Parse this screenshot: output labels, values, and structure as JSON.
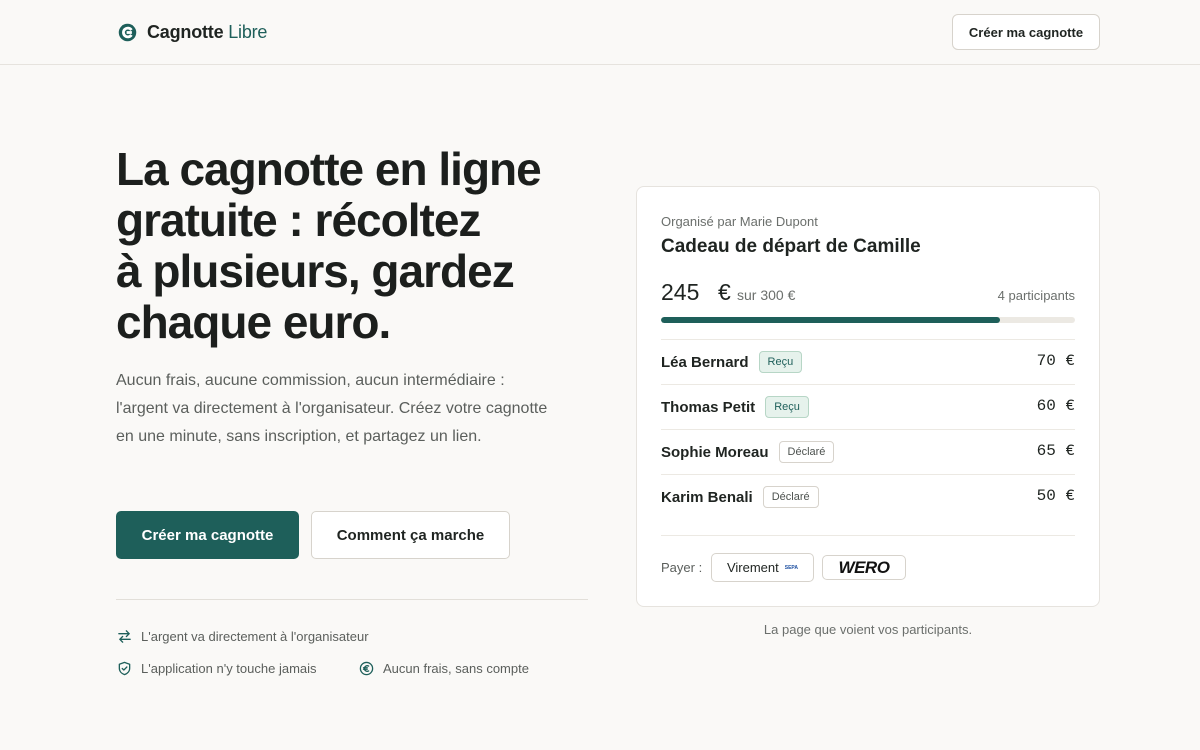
{
  "header": {
    "brand_name": "Cagnotte",
    "brand_accent": "Libre",
    "cta_label": "Créer ma cagnotte"
  },
  "hero": {
    "title_lines": [
      "La cagnotte en ligne",
      "gratuite : récoltez",
      "à plusieurs, gardez",
      "chaque euro."
    ],
    "description": "Aucun frais, aucune commission, aucun intermédiaire : l'argent va directement à l'organisateur. Créez votre cagnotte en une minute, sans inscription, et partagez un lien.",
    "primary_button": "Créer ma cagnotte",
    "secondary_button": "Comment ça marche"
  },
  "features": [
    {
      "label": "L'argent va directement à l'organisateur",
      "icon": "transfer-arrows-icon"
    },
    {
      "label": "L'application n'y touche jamais",
      "icon": "shield-check-icon"
    },
    {
      "label": "Aucun frais, sans compte",
      "icon": "euro-circle-icon"
    }
  ],
  "card": {
    "organizer": "Organisé par Marie Dupont",
    "title": "Cadeau de départ de Camille",
    "amount": "245",
    "currency": "€",
    "goal": "sur 300 €",
    "participants": "4 participants",
    "progress": 0.82,
    "rows": [
      {
        "name": "Léa Bernard",
        "status": "Reçu",
        "amount": "70 €"
      },
      {
        "name": "Thomas Petit",
        "status": "Reçu",
        "amount": "60 €"
      },
      {
        "name": "Sophie Moreau",
        "status": "Déclaré",
        "amount": "65 €"
      },
      {
        "name": "Karim Benali",
        "status": "Déclaré",
        "amount": "50 €"
      }
    ],
    "pay_label": "Payer :",
    "pay_virement": "Virement",
    "pay_virement_badge": "SEPA",
    "pay_wero": "WERO",
    "caption": "La page que voient vos participants."
  },
  "colors": {
    "accent": "#1e5f5a",
    "background": "#faf9f7"
  }
}
